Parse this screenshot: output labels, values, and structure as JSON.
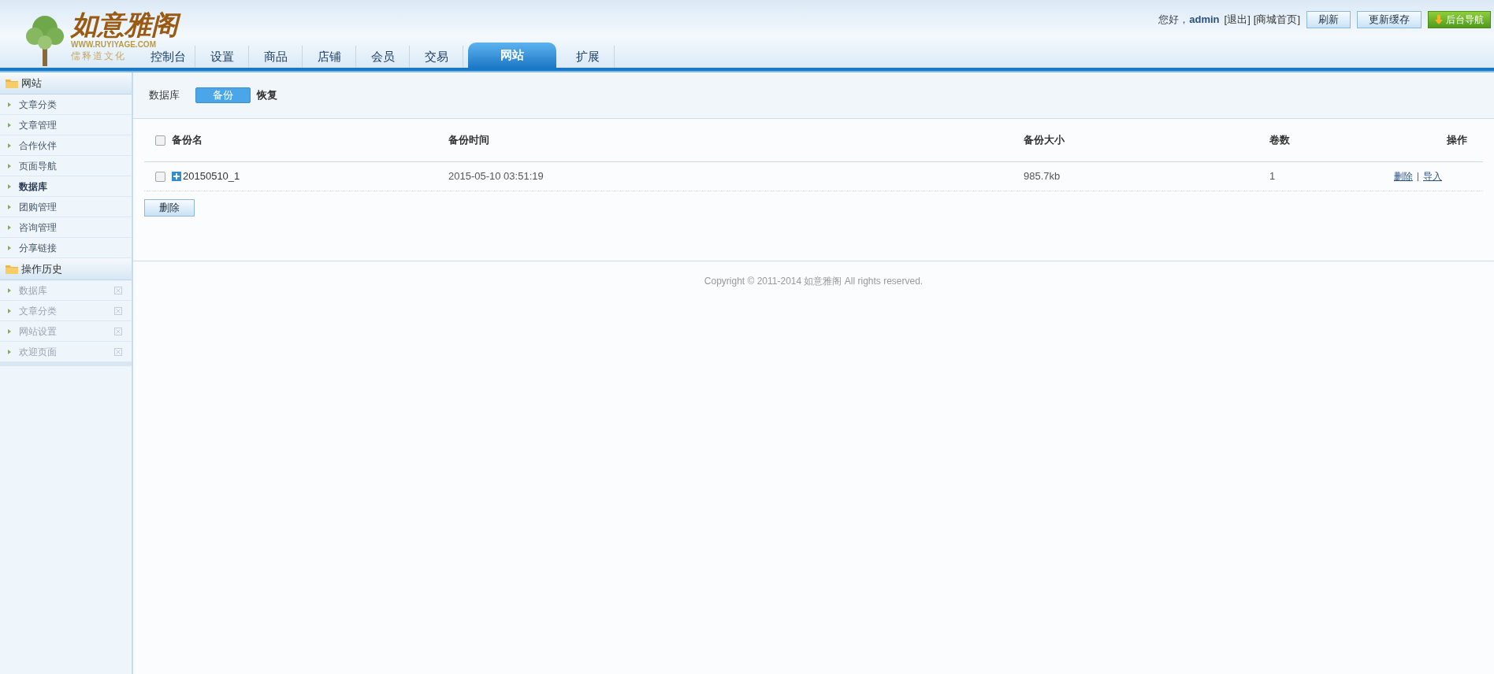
{
  "header": {
    "logo": {
      "title": "如意雅阁",
      "url": "WWW.RUYIYAGE.COM",
      "slogan": "儒释道文化"
    },
    "greeting": "您好，",
    "user": "admin",
    "links": [
      "[退出]",
      "[商城首页]"
    ],
    "buttons": [
      {
        "label": "刷新",
        "kind": "plain"
      },
      {
        "label": "更新缓存",
        "kind": "plain"
      },
      {
        "label": "后台导航",
        "kind": "primary"
      }
    ]
  },
  "nav_tabs": [
    {
      "label": "控制台",
      "selected": false
    },
    {
      "label": "设置",
      "selected": false
    },
    {
      "label": "商品",
      "selected": false
    },
    {
      "label": "店铺",
      "selected": false
    },
    {
      "label": "会员",
      "selected": false
    },
    {
      "label": "交易",
      "selected": false
    },
    {
      "label": "网站",
      "selected": true
    },
    {
      "label": "扩展",
      "selected": false
    }
  ],
  "sidebar": {
    "sections": [
      {
        "title": "网站",
        "kind": "menu",
        "items": [
          {
            "label": "文章分类",
            "selected": false
          },
          {
            "label": "文章管理",
            "selected": false
          },
          {
            "label": "合作伙伴",
            "selected": false
          },
          {
            "label": "页面导航",
            "selected": false
          },
          {
            "label": "数据库",
            "selected": true
          },
          {
            "label": "团购管理",
            "selected": false
          },
          {
            "label": "咨询管理",
            "selected": false
          },
          {
            "label": "分享链接",
            "selected": false
          }
        ]
      },
      {
        "title": "操作历史",
        "kind": "history",
        "items": [
          {
            "label": "数据库",
            "selected": false
          },
          {
            "label": "文章分类",
            "selected": false
          },
          {
            "label": "网站设置",
            "selected": false
          },
          {
            "label": "欢迎页面",
            "selected": false
          }
        ]
      }
    ]
  },
  "content": {
    "breadcrumb": "数据库",
    "subtabs": [
      {
        "label": "备份",
        "selected": true
      },
      {
        "label": "恢复",
        "selected": false
      }
    ],
    "table": {
      "select_all": {
        "checked": false
      },
      "columns": [
        "备份名",
        "备份时间",
        "备份大小",
        "卷数",
        "操作"
      ],
      "rows": [
        {
          "checked": false,
          "name": "20150510_1",
          "time": "2015-05-10 03:51:19",
          "size": "985.7kb",
          "volumes": "1",
          "actions": [
            "删除",
            "导入"
          ]
        }
      ]
    },
    "delete_button": "删除"
  },
  "footer": "Copyright © 2011-2014 如意雅阁 All rights reserved."
}
